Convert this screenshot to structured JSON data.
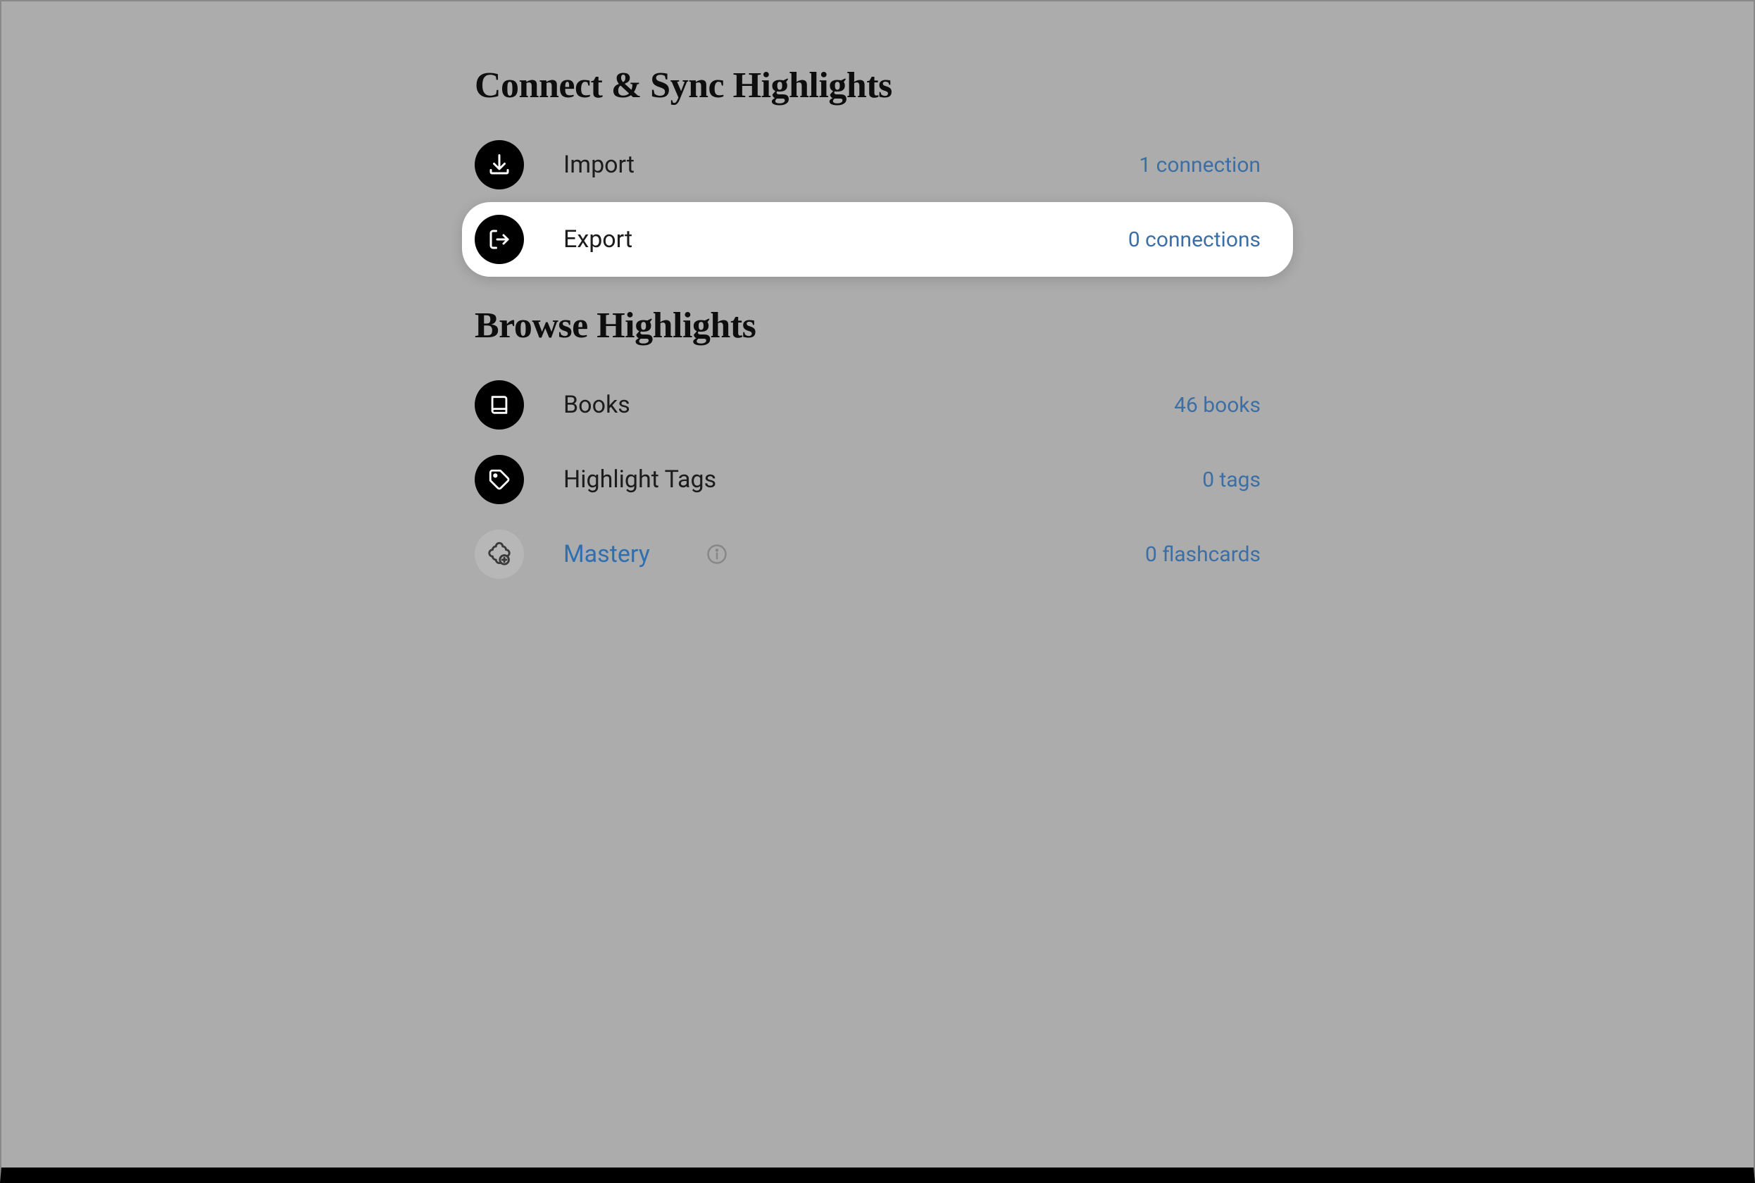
{
  "sections": {
    "connect": {
      "title": "Connect & Sync Highlights",
      "items": [
        {
          "label": "Import",
          "meta": "1 connection"
        },
        {
          "label": "Export",
          "meta": "0 connections"
        }
      ]
    },
    "browse": {
      "title": "Browse Highlights",
      "items": [
        {
          "label": "Books",
          "meta": "46 books"
        },
        {
          "label": "Highlight Tags",
          "meta": "0 tags"
        },
        {
          "label": "Mastery",
          "meta": "0 flashcards"
        }
      ]
    }
  }
}
